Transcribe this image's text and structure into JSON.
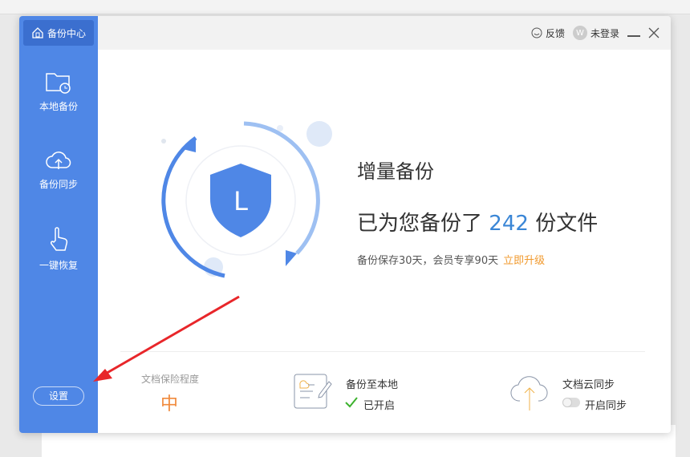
{
  "header": {
    "brand": "备份中心",
    "feedback": "反馈",
    "avatar_letter": "W",
    "login": "未登录"
  },
  "sidebar": {
    "items": [
      {
        "label": "本地备份",
        "icon": "folder-clock-icon"
      },
      {
        "label": "备份同步",
        "icon": "cloud-upload-icon"
      },
      {
        "label": "一键恢复",
        "icon": "hand-pointer-icon"
      }
    ],
    "settings": "设置"
  },
  "main": {
    "shield_letter": "L",
    "title": "增量备份",
    "backup_prefix": "已为您备份了",
    "backup_count": "242",
    "backup_suffix": "份文件",
    "note": "备份保存30天，会员专享90天",
    "upgrade": "立即升级"
  },
  "footer": {
    "protection_label": "文档保险程度",
    "protection_value": "中",
    "local_label": "备份至本地",
    "local_status": "已开启",
    "cloud_label": "文档云同步",
    "cloud_status": "开启同步"
  },
  "colors": {
    "sidebar": "#4f87e6",
    "accent": "#3a86d6",
    "upgrade": "#f19a2e",
    "arrow": "#e8262a"
  }
}
